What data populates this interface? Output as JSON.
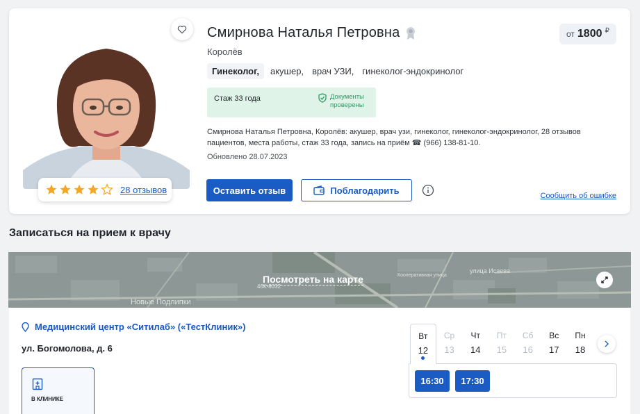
{
  "doctor": {
    "name": "Смирнова Наталья Петровна",
    "city": "Королёв",
    "specialties": [
      "Гинеколог,",
      "акушер,",
      "врач УЗИ,",
      "гинеколог-эндокринолог"
    ],
    "experience": "Стаж 33 года",
    "verified_line1": "Документы",
    "verified_line2": "проверены",
    "description": "Смирнова Наталья Петровна, Королёв: акушер, врач узи, гинеколог, гинеколог-эндокринолог, 28 отзывов пациентов, места работы, стаж 33 года, запись на приём ☎ (966) 138-81-10.",
    "updated": "Обновлено 28.07.2023",
    "rating_stars": 4,
    "rating_max": 5,
    "reviews_link": "28 отзывов"
  },
  "price": {
    "from": "от",
    "value": "1800",
    "currency": "₽"
  },
  "actions": {
    "leave_review": "Оставить отзыв",
    "thank": "Поблагодарить",
    "report_error": "Сообщить об ошибке"
  },
  "booking": {
    "title": "Записаться на прием к врачу",
    "map_link": "Посмотреть на карте",
    "map_labels": {
      "road_code": "46К-8032",
      "district": "Новые Подлипки",
      "street1": "улица Исаева",
      "street2": "Кооперативная улица"
    },
    "clinic_name": "Медицинский центр «Ситилаб» («ТестКлиник»)",
    "address": "ул. Богомолова, д. 6",
    "visit_type": "В КЛИНИКЕ",
    "days": [
      {
        "name": "Вт",
        "num": "12",
        "active": true
      },
      {
        "name": "Ср",
        "num": "13",
        "muted": true
      },
      {
        "name": "Чт",
        "num": "14"
      },
      {
        "name": "Пт",
        "num": "15",
        "muted": true
      },
      {
        "name": "Сб",
        "num": "16",
        "muted": true
      },
      {
        "name": "Вс",
        "num": "17"
      },
      {
        "name": "Пн",
        "num": "18"
      }
    ],
    "slots": [
      "16:30",
      "17:30"
    ]
  },
  "colors": {
    "accent": "#1a5bc4",
    "verified_bg": "#dff3e8",
    "verified_text": "#2f9a62",
    "star": "#f5a623"
  }
}
